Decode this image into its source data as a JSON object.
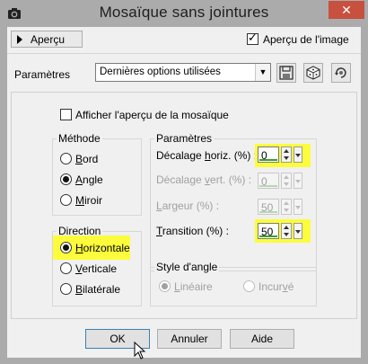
{
  "window": {
    "title": "Mosaïque sans jointures",
    "close_glyph": "✕"
  },
  "toolbar": {
    "preview_toggle_label": "Aperçu",
    "image_preview_label": "Aperçu de l'image",
    "image_preview_checked": true
  },
  "presets": {
    "label": "Paramètres",
    "selected": "Dernières options utilisées",
    "buttons": [
      "save-icon",
      "randomize-icon",
      "reset-icon"
    ]
  },
  "options": {
    "show_tile_preview_label": "Afficher l'aperçu de la mosaïque",
    "show_tile_preview_checked": false
  },
  "method": {
    "title": "Méthode",
    "items": [
      {
        "label": "Bord",
        "checked": false
      },
      {
        "label": "Angle",
        "checked": true
      },
      {
        "label": "Miroir",
        "checked": false
      }
    ]
  },
  "direction": {
    "title": "Direction",
    "items": [
      {
        "label": "Horizontale",
        "checked": true
      },
      {
        "label": "Verticale",
        "checked": false
      },
      {
        "label": "Bilatérale",
        "checked": false
      }
    ]
  },
  "parameters": {
    "title": "Paramètres",
    "fields": [
      {
        "label": "Décalage horiz. (%) :",
        "value": "0",
        "enabled": true
      },
      {
        "label": "Décalage vert. (%) :",
        "value": "0",
        "enabled": false
      },
      {
        "label": "Largeur (%) :",
        "value": "50",
        "enabled": false
      },
      {
        "label": "Transition (%) :",
        "value": "50",
        "enabled": true
      }
    ]
  },
  "corner_style": {
    "title": "Style d'angle",
    "items": [
      {
        "label": "Linéaire",
        "checked": true,
        "enabled": false
      },
      {
        "label": "Incurvé",
        "checked": false,
        "enabled": false
      }
    ]
  },
  "buttons": {
    "ok": "OK",
    "cancel": "Annuler",
    "help": "Aide"
  },
  "colors": {
    "highlight": "#fcfc3c",
    "close": "#c7503f",
    "window_frame": "#ababab",
    "dialog_bg": "#f0f0f0"
  }
}
